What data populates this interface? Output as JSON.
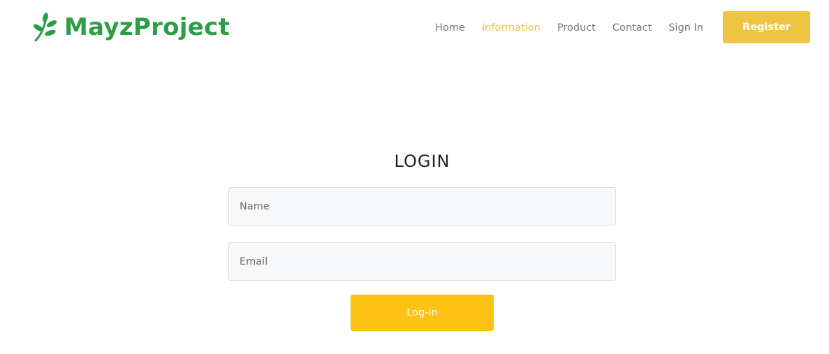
{
  "brand": {
    "name": "MayzProject",
    "icon": "leaf-branch-icon",
    "color": "#2c9e45"
  },
  "nav": {
    "items": [
      {
        "label": "Home",
        "active": false
      },
      {
        "label": "Information",
        "active": true
      },
      {
        "label": "Product",
        "active": false
      },
      {
        "label": "Contact",
        "active": false
      },
      {
        "label": "Sign In",
        "active": false
      }
    ],
    "register_label": "Register"
  },
  "login": {
    "title": "LOGIN",
    "name_field": {
      "placeholder": "Name",
      "value": ""
    },
    "email_field": {
      "placeholder": "Email",
      "value": ""
    },
    "submit_label": "Log-in"
  },
  "colors": {
    "accent": "#f0c443",
    "button": "#fdc214",
    "active_nav": "#f0c14b",
    "nav_text": "#777777"
  }
}
